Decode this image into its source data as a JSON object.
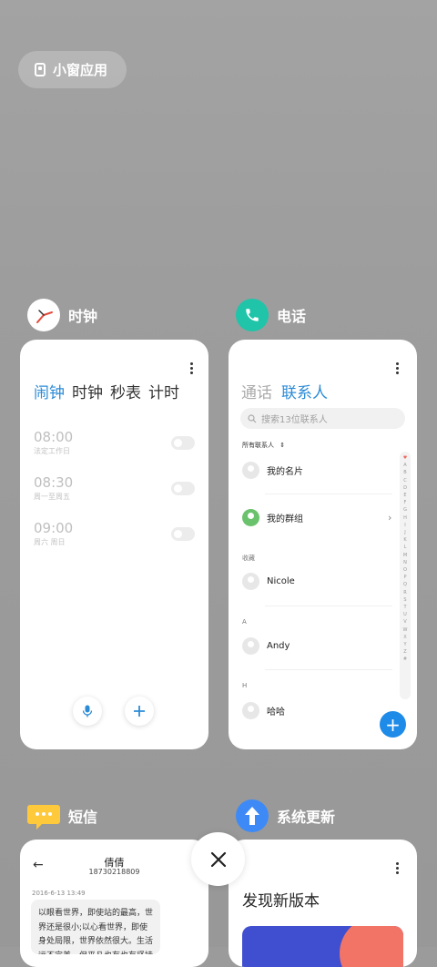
{
  "small_window": {
    "label": "小窗应用"
  },
  "apps": {
    "clock": {
      "name": "时钟",
      "tabs": [
        "闹钟",
        "时钟",
        "秒表",
        "计时"
      ],
      "alarms": [
        {
          "time": "08:00",
          "repeat": "法定工作日"
        },
        {
          "time": "08:30",
          "repeat": "周一至周五"
        },
        {
          "time": "09:00",
          "repeat": "周六 周日"
        }
      ]
    },
    "phone": {
      "name": "电话",
      "tabs": [
        "通话",
        "联系人"
      ],
      "search_placeholder": "搜索13位联系人",
      "filter": "所有联系人",
      "my_card": "我的名片",
      "my_groups": "我的群组",
      "sections": [
        {
          "header": "收藏",
          "name": "Nicole"
        },
        {
          "header": "A",
          "name": "Andy"
        },
        {
          "header": "H",
          "name": "哈哈"
        }
      ],
      "alphabet": [
        "♥",
        "A",
        "B",
        "C",
        "D",
        "E",
        "F",
        "G",
        "H",
        "I",
        "J",
        "K",
        "L",
        "M",
        "N",
        "O",
        "P",
        "Q",
        "R",
        "S",
        "T",
        "U",
        "V",
        "W",
        "X",
        "Y",
        "Z",
        "#"
      ]
    },
    "sms": {
      "name": "短信",
      "contact_name": "倩倩",
      "contact_number": "18730218809",
      "timestamp": "2016-6-13 13:49",
      "message": "以眼看世界，即使站的最高，世界还是很小;以心看世界，即使身处局限，世界依然很大。生活远不完美，但平凡也有也有坚持"
    },
    "update": {
      "name": "系统更新",
      "heading": "发现新版本"
    }
  },
  "colors": {
    "accent": "#2b8bd6",
    "phone_icon": "#1fc4a9",
    "sms_icon": "#ffc93c",
    "update_icon": "#3d8af7"
  }
}
